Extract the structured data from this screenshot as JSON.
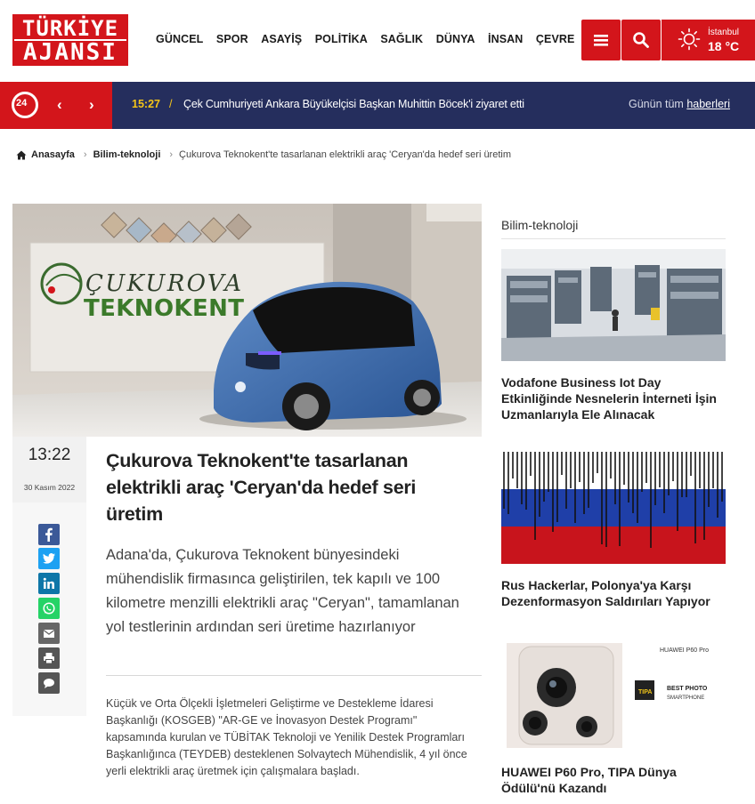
{
  "header": {
    "logo_line1": "TÜRKİYE",
    "logo_line2": "AJANSI",
    "nav": [
      "GÜNCEL",
      "SPOR",
      "ASAYİŞ",
      "POLİTİKA",
      "SAĞLIK",
      "DÜNYA",
      "İNSAN",
      "ÇEVRE"
    ],
    "weather": {
      "city": "İstanbul",
      "temp": "18 °C"
    }
  },
  "ticker": {
    "badge": "24",
    "time": "15:27",
    "separator": "/",
    "text": "Çek Cumhuriyeti Ankara Büyükelçisi Başkan Muhittin Böcek'i ziyaret etti",
    "all_prefix": "Günün tüm ",
    "all_link": "haberleri"
  },
  "breadcrumb": {
    "home": "Anasayfa",
    "category": "Bilim-teknoloji",
    "current": "Çukurova Teknokent'te tasarlanan elektrikli araç 'Ceryan'da hedef seri üretim"
  },
  "hero": {
    "sign_line1": "ÇUKUROVA",
    "sign_line2": "TEKNOKENT"
  },
  "article": {
    "time": "13:22",
    "date": "30 Kasım 2022",
    "title": "Çukurova Teknokent'te tasarlanan elektrikli araç 'Ceryan'da hedef seri üretim",
    "lead": "Adana'da, Çukurova Teknokent bünyesindeki mühendislik firmasınca geliştirilen, tek kapılı ve 100 kilometre menzilli elektrikli araç \"Ceryan\", tamamlanan yol testlerinin ardından seri üretime hazırlanıyor",
    "body": "Küçük ve Orta Ölçekli İşletmeleri Geliştirme ve Destekleme İdaresi Başkanlığı (KOSGEB) \"AR-GE ve İnovasyon Destek Programı\" kapsamında kurulan ve TÜBİTAK Teknoloji ve Yenilik Destek Programları Başkanlığınca (TEYDEB) desteklenen Solvaytech Mühendislik, 4 yıl önce yerli elektrikli araç üretmek için çalışmalara başladı."
  },
  "share": [
    "facebook-icon",
    "twitter-icon",
    "linkedin-icon",
    "whatsapp-icon",
    "email-icon",
    "print-icon",
    "comment-icon"
  ],
  "sidebar": {
    "heading": "Bilim-teknoloji",
    "cards": [
      {
        "title": "Vodafone Business Iot Day Etkinliğinde Nesnelerin İnterneti İşin Uzmanlarıyla Ele Alınacak"
      },
      {
        "title": "Rus Hackerlar, Polonya'ya Karşı Dezenformasyon Saldırıları Yapıyor"
      },
      {
        "title": "HUAWEI P60 Pro, TIPA Dünya Ödülü'nü Kazandı",
        "img_brand": "HUAWEI P60 Pro",
        "img_badge": "TIPA",
        "img_award1": "BEST PHOTO",
        "img_award2": "SMARTPHONE"
      }
    ]
  },
  "colors": {
    "brand_red": "#d3151b",
    "ticker_bg": "#252e5d",
    "ticker_time": "#f5c518"
  }
}
